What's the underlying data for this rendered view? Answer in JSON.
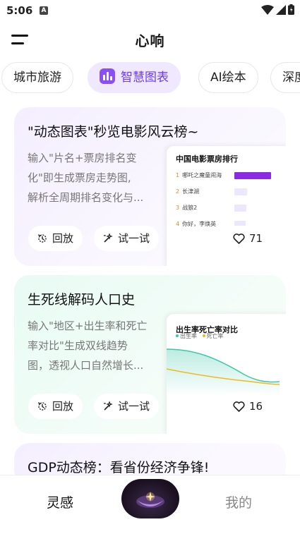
{
  "status_bar": {
    "time": "5:06",
    "notification_icon": "A"
  },
  "header": {
    "title": "心响"
  },
  "tabs": [
    {
      "label": "城市旅游"
    },
    {
      "label": "智慧图表"
    },
    {
      "label": "AI绘本"
    },
    {
      "label": "深度"
    }
  ],
  "cards": [
    {
      "title": "\"动态图表\"秒览电影风云榜~",
      "desc_lines": [
        "输入\"片名+票房排名变",
        "化\"即生成票房走势图,",
        "解析全周期排名变化与..."
      ],
      "replay_label": "回放",
      "try_label": "试一试",
      "likes": "71",
      "preview": {
        "title": "中国电影票房排行",
        "rows": [
          {
            "rank": "1",
            "name": "哪吒之魔童闹海",
            "value": 1.0
          },
          {
            "rank": "2",
            "name": "长津湖",
            "value": 0.35
          },
          {
            "rank": "3",
            "name": "战狼2",
            "value": 0.33
          },
          {
            "rank": "4",
            "name": "你好，李焕英",
            "value": 0.3
          }
        ]
      }
    },
    {
      "title": "生死线解码人口史",
      "desc_lines": [
        "输入\"地区+出生率和死亡",
        "率对比\"生成双线趋势",
        "图，透视人口自然增长..."
      ],
      "replay_label": "回放",
      "try_label": "试一试",
      "likes": "16",
      "preview": {
        "title": "出生率死亡率对比",
        "legend": [
          {
            "name": "出生率",
            "color": "#3cc8a8"
          },
          {
            "name": "死亡率",
            "color": "#f0b81e"
          }
        ]
      }
    },
    {
      "title": "GDP动态榜：看省份经济争锋!"
    }
  ],
  "bottom_nav": {
    "left_label": "灵感",
    "right_label": "我的"
  },
  "colors": {
    "accent": "#6b3cf2",
    "bar": "#8a2be2",
    "birth_line": "#3cc8a8",
    "death_line": "#f0b81e"
  }
}
